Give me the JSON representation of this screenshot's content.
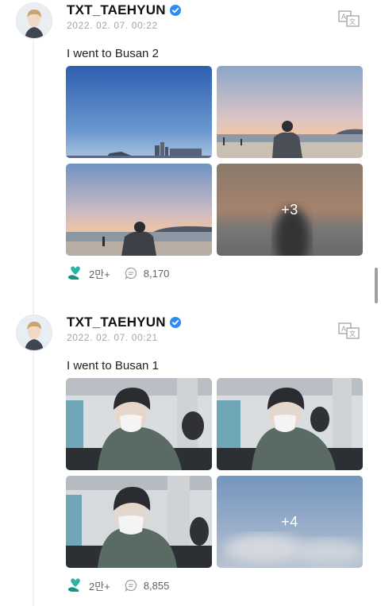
{
  "posts": [
    {
      "username": "TXT_TAEHYUN",
      "timestamp": "2022. 02. 07. 00:22",
      "caption": "I went to Busan 2",
      "more_count": "+3",
      "likes": "2만+",
      "comments": "8,170"
    },
    {
      "username": "TXT_TAEHYUN",
      "timestamp": "2022. 02. 07. 00:21",
      "caption": "I went to Busan 1",
      "more_count": "+4",
      "likes": "2만+",
      "comments": "8,855"
    }
  ],
  "icons": {
    "verified": "verified-badge-icon",
    "translate": "translate-icon",
    "likes": "heart-hand-icon",
    "comments": "comment-bubble-icon"
  },
  "colors": {
    "verified_blue": "#2c8cf4",
    "like_teal": "#2bb4a6",
    "meta_gray": "#a0a5ab"
  }
}
